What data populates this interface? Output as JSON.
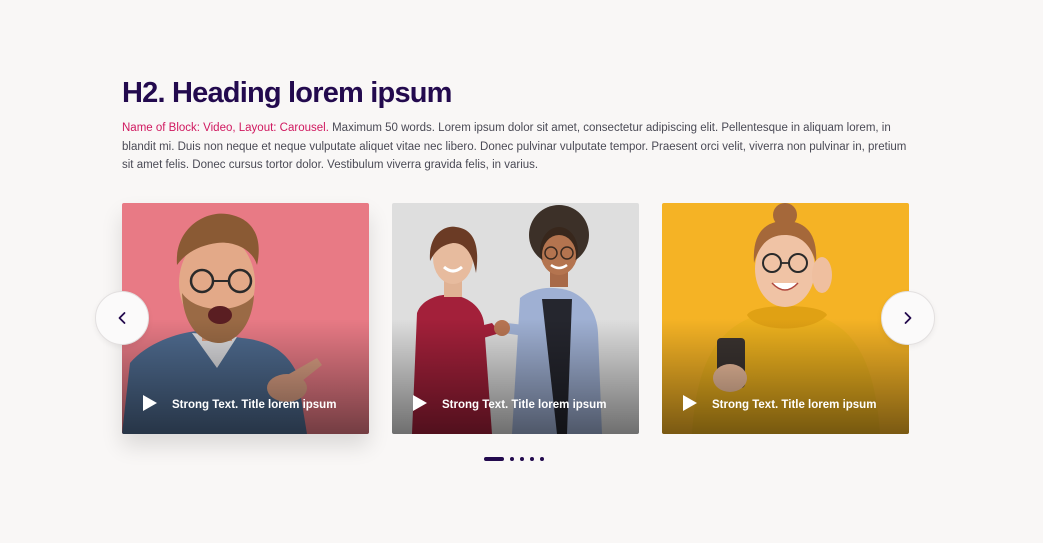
{
  "section": {
    "heading": "H2. Heading lorem ipsum",
    "desc_accent": "Name of Block: Video, Layout: Carousel.",
    "desc_body": " Maximum 50 words. Lorem ipsum dolor sit amet, consectetur adipiscing elit. Pellentesque in aliquam lorem, in blandit mi. Duis non neque et neque vulputate aliquet vitae nec libero. Donec pulvinar vulputate tempor. Praesent orci velit, viverra non pulvinar in, pretium sit amet felis. Donec cursus tortor dolor. Vestibulum viverra gravida felis, in varius."
  },
  "carousel": {
    "cards": [
      {
        "title": "Strong Text. Title lorem ipsum",
        "background": "#e87a85"
      },
      {
        "title": "Strong Text. Title lorem ipsum",
        "background": "#dedede"
      },
      {
        "title": "Strong Text. Title lorem ipsum",
        "background": "#f5b325"
      }
    ],
    "prev_icon": "chevron-left-icon",
    "next_icon": "chevron-right-icon",
    "dot_count": 5,
    "active_dot": 1
  },
  "colors": {
    "heading": "#230a4e",
    "accent": "#d0185f",
    "background": "#f9f7f6"
  }
}
